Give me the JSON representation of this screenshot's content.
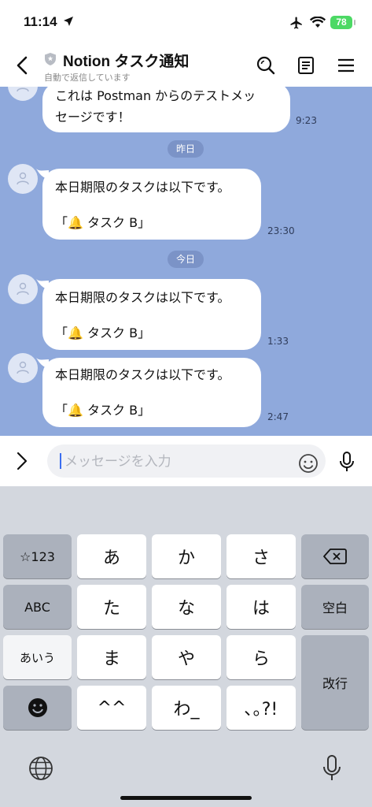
{
  "status_bar": {
    "time": "11:14",
    "battery": "78"
  },
  "header": {
    "title": "Notion タスク通知",
    "subtitle": "自動で返信しています"
  },
  "messages": [
    {
      "lines": [
        "これは Postman からのテストメッ",
        "セージです！"
      ],
      "time": "9:23"
    },
    {
      "lines": [
        "本日期限のタスクは以下です。",
        "「🔔 タスク B」"
      ],
      "time": "23:30"
    },
    {
      "lines": [
        "本日期限のタスクは以下です。",
        "「🔔 タスク B」"
      ],
      "time": "1:33"
    },
    {
      "lines": [
        "本日期限のタスクは以下です。",
        "「🔔 タスク B」"
      ],
      "time": "2:47"
    }
  ],
  "date_separators": [
    "昨日",
    "今日"
  ],
  "input": {
    "placeholder": "メッセージを入力"
  },
  "keyboard": {
    "row1": [
      "☆123",
      "あ",
      "か",
      "さ"
    ],
    "row2": [
      "ABC",
      "た",
      "な",
      "は",
      "空白"
    ],
    "row3": [
      "あいう",
      "ま",
      "や",
      "ら",
      "改行"
    ],
    "row4": [
      "^^",
      "わ_",
      "､｡?!"
    ],
    "emoji_key": "emoji-icon",
    "delete_key": "backspace-icon"
  }
}
